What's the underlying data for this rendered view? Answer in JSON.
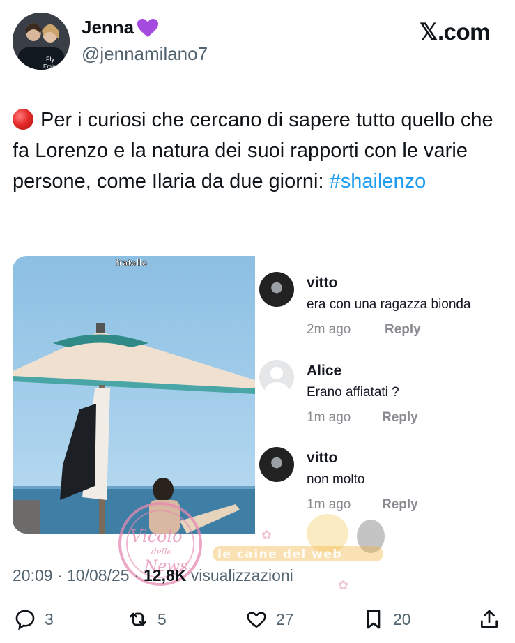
{
  "user": {
    "display_name": "Jenna",
    "handle": "@jennamilano7",
    "name_emoji": "purple-heart"
  },
  "brand": {
    "label": "𝕏.com"
  },
  "tweet": {
    "text_main": "Per i curiosi che cercano di sapere tutto quello che fa Lorenzo e la natura dei suoi rapporti con le varie persone, come Ilaria da due giorni: ",
    "hashtag": "#shailenzo",
    "leading_emoji": "red-circle"
  },
  "media": {
    "label": "fratello"
  },
  "comments": [
    {
      "name": "vitto",
      "text": "era con una ragazza bionda",
      "time": "2m ago",
      "reply_label": "Reply",
      "avatar": "dark"
    },
    {
      "name": "Alice",
      "text": "Erano affiatati ?",
      "time": "1m ago",
      "reply_label": "Reply",
      "avatar": "default"
    },
    {
      "name": "vitto",
      "text": "non molto",
      "time": "1m ago",
      "reply_label": "Reply",
      "avatar": "dark"
    }
  ],
  "meta": {
    "time": "20:09",
    "date": "10/08/25",
    "views_count": "12,8K",
    "views_label": "visualizzazioni",
    "separator": "·"
  },
  "actions": {
    "replies": "3",
    "reposts": "5",
    "likes": "27",
    "bookmarks": "20"
  },
  "watermarks": {
    "stamp_text": "Vicolo delle News",
    "stamp_middle": "delle",
    "banner_text": "le caine del web"
  },
  "colors": {
    "accent": "#1d9bf0",
    "text": "#0f1419",
    "secondary": "#536471"
  }
}
